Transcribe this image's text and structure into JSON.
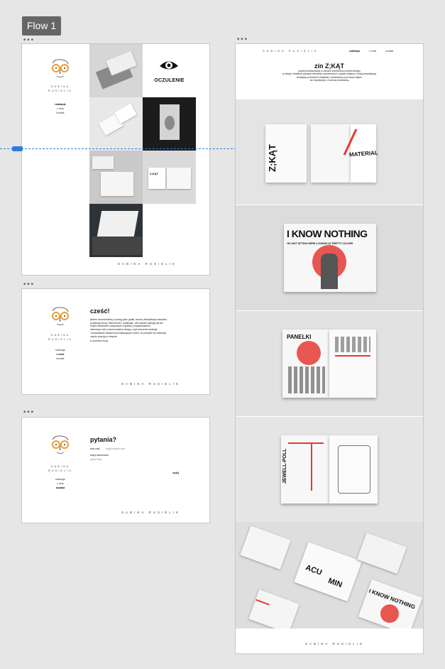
{
  "flow": {
    "label": "Flow 1",
    "dots": "•••"
  },
  "brand": {
    "line1": "SABINA",
    "line2": "RUSIELIK",
    "footer": "SABINA RUSIELIK"
  },
  "nav": {
    "projects": "realizacje",
    "about": "o mnie",
    "contact": "kontakt"
  },
  "portfolio": {
    "logo_text": "OCZULENIE",
    "book_title": "Z;KĄT"
  },
  "about": {
    "heading": "cześć!",
    "lines": [
      "jestem szczecinianką i pracuję jako grafik, tworzę identyfikacje wizualne,",
      "projektuję strony internetowe i publikacje, ale chętnie zajmuję się też",
      "innymi zadaniami związanymi z grafiką i projektowaniem.",
      "interesuje mnie communication design, czyli tworzenie strategii",
      "i prowadzenie działań komunikacyjnych marki, od pomysłu do realizacji.",
      "często pracuję w zespole."
    ],
    "more": "tu poznasz moją."
  },
  "contact": {
    "heading": "pytania?",
    "email_label": "twój mail:",
    "email_placeholder": "hej@mojmail.com",
    "message_label": "twoja wiadomość:",
    "message_placeholder": "wpisz tutaj...",
    "send": "wyślij"
  },
  "zin": {
    "title": "zin Z;KĄT",
    "desc": [
      "projekt zrealizowany w ramach przedmiotu content design",
      "w którym chciałam pokazać elementy codzienności i zwykłe miejsca z innej perspektywy",
      "tematykę przestrzeni miejskiej i architektury pod innym kątem",
      "we współpracy z Joanną Jankowską"
    ],
    "spreads": {
      "material": "MATERIAL",
      "know_nothing": "I KNOW NOTHING",
      "know_sub": "I'M JUST SITTING HERE LOOKING AT PRETTY COLORS",
      "panelki": "PANELKI",
      "jewell": "JEWELL-POLL",
      "acu": "ACU",
      "min": "MIN",
      "know_short": "I KNOW NOTHING"
    }
  },
  "colors": {
    "accent_red": "#e53935",
    "orange": "#f39c2a",
    "connector_blue": "#2f7ce0"
  }
}
